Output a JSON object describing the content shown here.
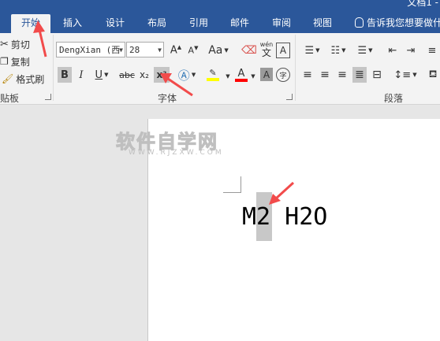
{
  "window": {
    "title": "文档1 -"
  },
  "tabs": [
    "开始",
    "插入",
    "设计",
    "布局",
    "引用",
    "邮件",
    "审阅",
    "视图"
  ],
  "active_tab": "开始",
  "tell_me": "告诉我您想要做什么",
  "clipboard": {
    "cut": "剪切",
    "copy": "复制",
    "format_painter": "格式刷",
    "group_label": "贴板"
  },
  "font": {
    "name": "DengXian (西",
    "size": "28",
    "group_label": "字体",
    "case_label": "Aa",
    "bold": "B",
    "italic": "I",
    "underline": "U",
    "strike": "abc",
    "subscript": "x₂",
    "superscript": "x²",
    "phonetic_top": "wén",
    "phonetic_bottom": "文",
    "border_char": "A",
    "shade_char": "A",
    "enclose_char": "字"
  },
  "paragraph": {
    "group_label": "段落"
  },
  "document": {
    "text": "M2 H2O"
  },
  "watermark": {
    "main": "软件自学网",
    "sub": "WWW.RJZXW.COM"
  },
  "colors": {
    "title_bar": "#2b579a",
    "highlight": "#ffff00",
    "font_color": "#ff0000",
    "arrow": "#f24b4b"
  }
}
